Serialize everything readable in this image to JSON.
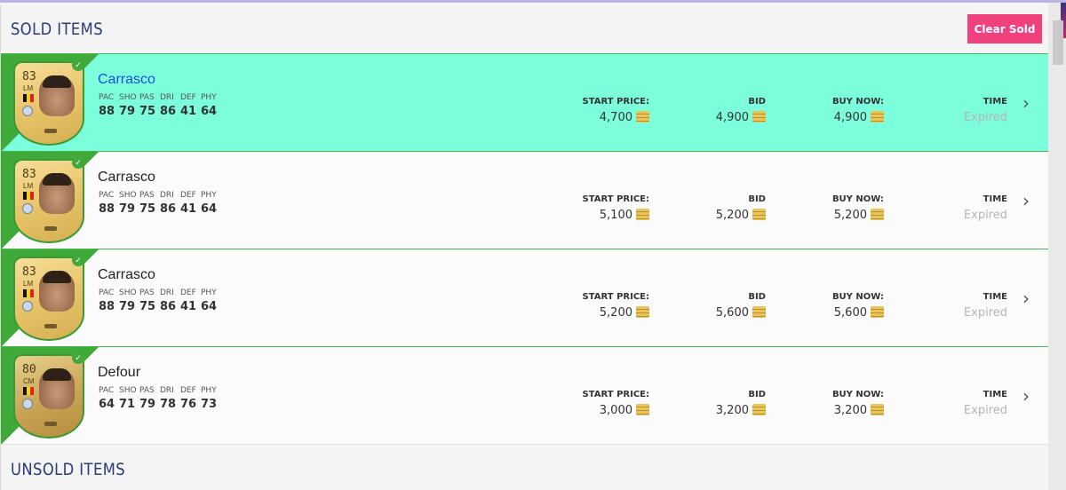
{
  "sold": {
    "title": "SOLD ITEMS",
    "clear_label": "Clear Sold"
  },
  "unsold": {
    "title": "UNSOLD ITEMS"
  },
  "stat_labels": [
    "PAC",
    "SHO",
    "PAS",
    "DRI",
    "DEF",
    "PHY"
  ],
  "columns": {
    "start": "START PRICE:",
    "bid": "BID",
    "buy": "BUY NOW:",
    "time": "TIME"
  },
  "items": [
    {
      "name": "Carrasco",
      "rating": "83",
      "position": "LM",
      "stats": [
        "88",
        "79",
        "75",
        "86",
        "41",
        "64"
      ],
      "start": "4,700",
      "bid": "4,900",
      "buy": "4,900",
      "time": "Expired",
      "selected": true
    },
    {
      "name": "Carrasco",
      "rating": "83",
      "position": "LM",
      "stats": [
        "88",
        "79",
        "75",
        "86",
        "41",
        "64"
      ],
      "start": "5,100",
      "bid": "5,200",
      "buy": "5,200",
      "time": "Expired",
      "selected": false
    },
    {
      "name": "Carrasco",
      "rating": "83",
      "position": "LM",
      "stats": [
        "88",
        "79",
        "75",
        "86",
        "41",
        "64"
      ],
      "start": "5,200",
      "bid": "5,600",
      "buy": "5,600",
      "time": "Expired",
      "selected": false
    },
    {
      "name": "Defour",
      "rating": "80",
      "position": "CM",
      "stats": [
        "64",
        "71",
        "79",
        "78",
        "76",
        "73"
      ],
      "start": "3,000",
      "bid": "3,200",
      "buy": "3,200",
      "time": "Expired",
      "selected": false
    }
  ],
  "colors": {
    "selected_row": "#7cfddc",
    "accent_green": "#3faa3a",
    "clear_button": "#f0407d",
    "title_color": "#2b3a7a"
  },
  "icons": {
    "check": "check-icon",
    "coin": "coin-icon",
    "chevron": "chevron-right-icon"
  }
}
